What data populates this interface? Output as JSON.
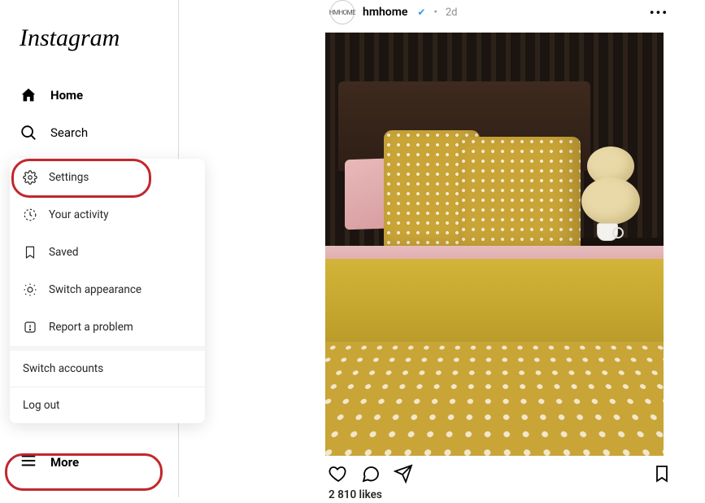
{
  "app": {
    "logo": "Instagram"
  },
  "sidebar": {
    "home": "Home",
    "search": "Search",
    "more": "More"
  },
  "more_menu": {
    "settings": "Settings",
    "activity": "Your activity",
    "saved": "Saved",
    "appearance": "Switch appearance",
    "report": "Report a problem",
    "switch_accounts": "Switch accounts",
    "logout": "Log out"
  },
  "post": {
    "avatar_text": "HMHOME",
    "username": "hmhome",
    "verified": "✔",
    "dot": "•",
    "time": "2d",
    "options": "•••",
    "likes": "2 810 likes"
  }
}
